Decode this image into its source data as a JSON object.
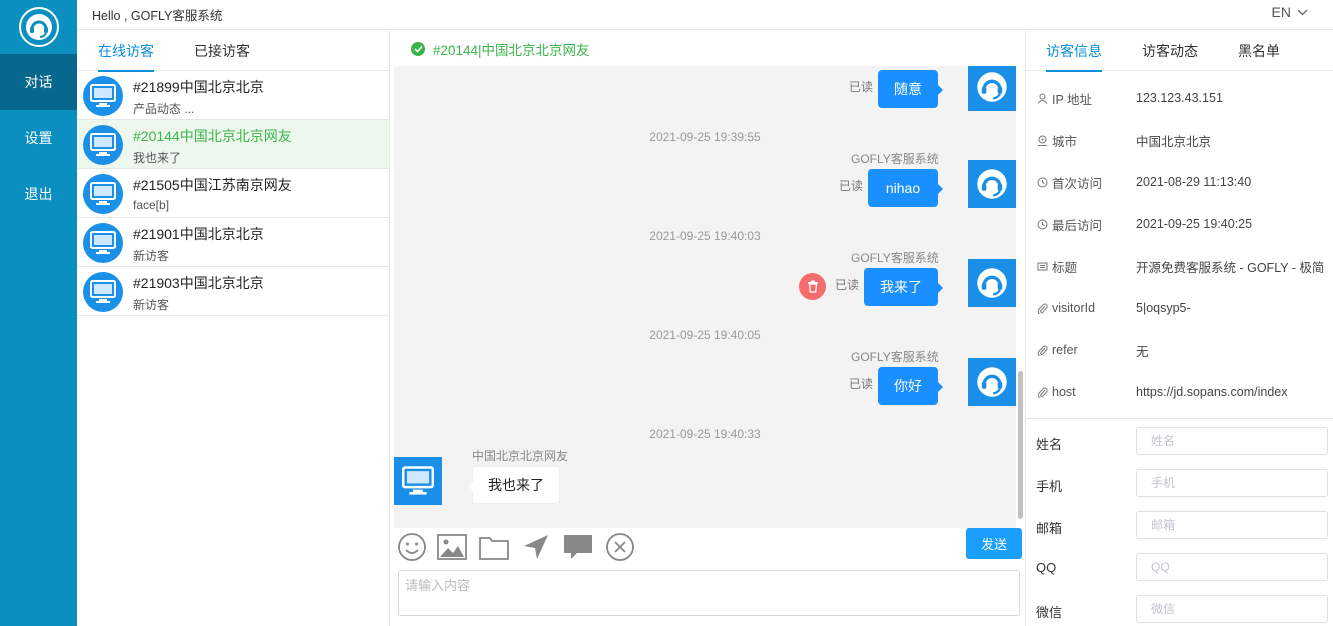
{
  "nav": {
    "items": [
      "对话",
      "设置",
      "退出"
    ]
  },
  "topbar": {
    "hello": "Hello , GOFLY客服系统",
    "lang": "EN"
  },
  "visitors": {
    "tabs": [
      "在线访客",
      "已接访客"
    ],
    "rows": [
      {
        "name": "#21899中国北京北京",
        "last": "产品动态 ..."
      },
      {
        "name": "#20144中国北京北京网友",
        "last": "我也来了"
      },
      {
        "name": "#21505中国江苏南京网友",
        "last": "face[b]"
      },
      {
        "name": "#21901中国北京北京",
        "last": "新访客"
      },
      {
        "name": "#21903中国北京北京",
        "last": "新访客"
      }
    ]
  },
  "chat": {
    "title": "#20144|中国北京北京网友",
    "messages": [
      {
        "read": "已读",
        "text": "随意"
      },
      {
        "time": "2021-09-25 19:39:55",
        "sender": "GOFLY客服系统",
        "read": "已读",
        "text": "nihao"
      },
      {
        "time": "2021-09-25 19:40:03",
        "sender": "GOFLY客服系统",
        "read": "已读",
        "text": "我来了"
      },
      {
        "time": "2021-09-25 19:40:05",
        "sender": "GOFLY客服系统",
        "read": "已读",
        "text": "你好"
      },
      {
        "time": "2021-09-25 19:40:33",
        "sender": "中国北京北京网友",
        "text": "我也来了"
      }
    ],
    "send_label": "发送",
    "input_placeholder": "请输入内容"
  },
  "info": {
    "tabs": [
      "访客信息",
      "访客动态",
      "黑名单"
    ],
    "rows": [
      {
        "label": "IP 地址",
        "value": "123.123.43.151",
        "icon": "user-icon"
      },
      {
        "label": "城市",
        "value": "中国北京北京",
        "icon": "location-icon"
      },
      {
        "label": "首次访问",
        "value": "2021-08-29 11:13:40",
        "icon": "clock-icon"
      },
      {
        "label": "最后访问",
        "value": "2021-09-25 19:40:25",
        "icon": "clock-icon"
      },
      {
        "label": "标题",
        "value": "开源免费客服系统 - GOFLY - 极简",
        "icon": "ticket-icon"
      },
      {
        "label": "visitorId",
        "value": "5|oqsyp5-",
        "icon": "paperclip-icon"
      },
      {
        "label": "refer",
        "value": "无",
        "icon": "paperclip-icon"
      },
      {
        "label": "host",
        "value": "https://jd.sopans.com/index",
        "icon": "paperclip-icon"
      }
    ],
    "fields": [
      {
        "label": "姓名",
        "placeholder": "姓名"
      },
      {
        "label": "手机",
        "placeholder": "手机"
      },
      {
        "label": "邮箱",
        "placeholder": "邮箱"
      },
      {
        "label": "QQ",
        "placeholder": "QQ"
      },
      {
        "label": "微信",
        "placeholder": "微信"
      }
    ]
  }
}
